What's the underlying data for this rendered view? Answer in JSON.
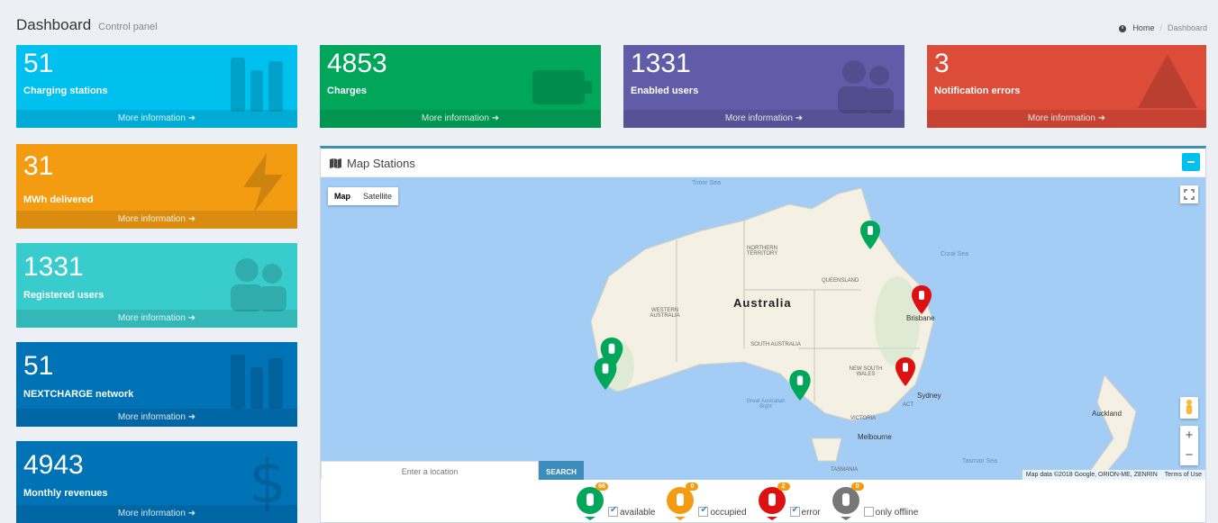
{
  "header": {
    "title": "Dashboard",
    "subtitle": "Control panel",
    "breadcrumb": {
      "home": "Home",
      "current": "Dashboard"
    }
  },
  "more_info": "More information",
  "left_boxes": [
    {
      "value": "51",
      "label": "Charging stations",
      "color": "#00c0ef"
    },
    {
      "value": "31",
      "label": "MWh delivered",
      "color": "#f39c12"
    },
    {
      "value": "1331",
      "label": "Registered users",
      "color": "#39cccc"
    },
    {
      "value": "51",
      "label": "NEXTCHARGE network",
      "color": "#0073b7"
    },
    {
      "value": "4943",
      "label": "Monthly revenues",
      "color": "#0073b7"
    }
  ],
  "top_boxes": [
    {
      "value": "4853",
      "label": "Charges",
      "color": "#00a65a"
    },
    {
      "value": "1331",
      "label": "Enabled users",
      "color": "#605ca8"
    },
    {
      "value": "3",
      "label": "Notification errors",
      "color": "#dd4b39"
    }
  ],
  "map_panel": {
    "title": "Map Stations",
    "map_type": {
      "map": "Map",
      "satellite": "Satellite"
    },
    "search_placeholder": "Enter a location",
    "search_button": "SEARCH",
    "attribution": "Map data ©2018 Google, ORION-ME, ZENRIN",
    "terms": "Terms of Use",
    "labels": {
      "country": "Australia",
      "nt": "NORTHERN TERRITORY",
      "qld": "QUEENSLAND",
      "wa": "WESTERN AUSTRALIA",
      "sa": "SOUTH AUSTRALIA",
      "nsw": "NEW SOUTH WALES",
      "vic": "VICTORIA",
      "tas": "TASMANIA",
      "act": "ACT",
      "brisbane": "Brisbane",
      "sydney": "Sydney",
      "melbourne": "Melbourne",
      "auckland": "Auckland",
      "timor": "Timor Sea",
      "coral": "Coral Sea",
      "tasman": "Tasman Sea",
      "bight": "Great Australian Bight"
    }
  },
  "legend": [
    {
      "label": "available",
      "count": "66",
      "color": "#00a65a",
      "checked": true
    },
    {
      "label": "occupied",
      "count": "0",
      "color": "#f39c12",
      "checked": true
    },
    {
      "label": "error",
      "count": "2",
      "color": "#dd1111",
      "checked": true
    },
    {
      "label": "only offline",
      "count": "0",
      "color": "#777777",
      "checked": false
    }
  ]
}
